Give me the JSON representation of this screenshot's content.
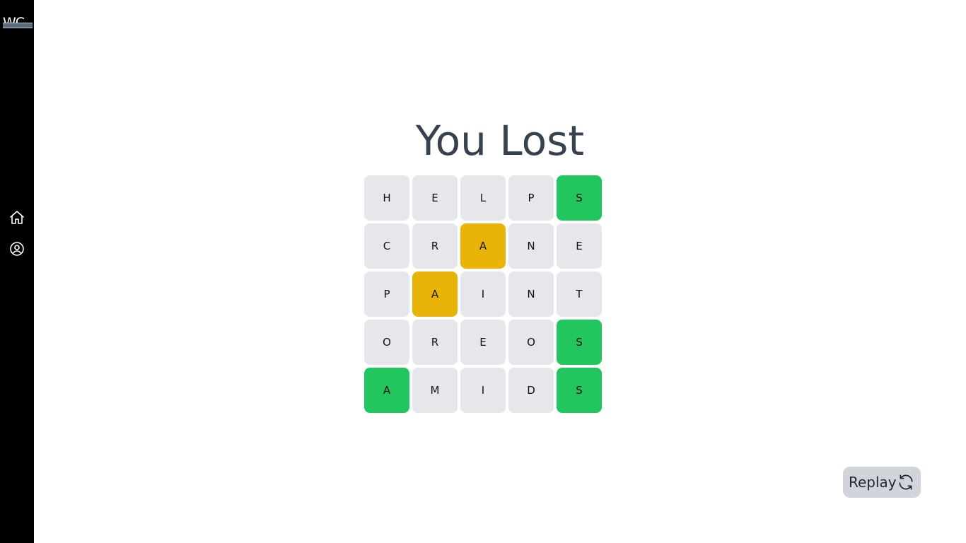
{
  "sidebar": {
    "logo_text": "WC",
    "nav": [
      {
        "icon": "home-icon"
      },
      {
        "icon": "user-circle-icon"
      }
    ]
  },
  "game": {
    "title": "You Lost",
    "rows": [
      [
        {
          "letter": "H",
          "status": "absent"
        },
        {
          "letter": "E",
          "status": "absent"
        },
        {
          "letter": "L",
          "status": "absent"
        },
        {
          "letter": "P",
          "status": "absent"
        },
        {
          "letter": "S",
          "status": "correct"
        }
      ],
      [
        {
          "letter": "C",
          "status": "absent"
        },
        {
          "letter": "R",
          "status": "absent"
        },
        {
          "letter": "A",
          "status": "present"
        },
        {
          "letter": "N",
          "status": "absent"
        },
        {
          "letter": "E",
          "status": "absent"
        }
      ],
      [
        {
          "letter": "P",
          "status": "absent"
        },
        {
          "letter": "A",
          "status": "present"
        },
        {
          "letter": "I",
          "status": "absent"
        },
        {
          "letter": "N",
          "status": "absent"
        },
        {
          "letter": "T",
          "status": "absent"
        }
      ],
      [
        {
          "letter": "O",
          "status": "absent"
        },
        {
          "letter": "R",
          "status": "absent"
        },
        {
          "letter": "E",
          "status": "absent"
        },
        {
          "letter": "O",
          "status": "absent"
        },
        {
          "letter": "S",
          "status": "correct"
        }
      ],
      [
        {
          "letter": "A",
          "status": "correct"
        },
        {
          "letter": "M",
          "status": "absent"
        },
        {
          "letter": "I",
          "status": "absent"
        },
        {
          "letter": "D",
          "status": "absent"
        },
        {
          "letter": "S",
          "status": "correct"
        }
      ]
    ]
  },
  "replay": {
    "label": "Replay",
    "icon": "refresh-icon"
  },
  "colors": {
    "correct": "#22c55e",
    "present": "#eab308",
    "absent": "#e5e7eb",
    "sidebar": "#000000",
    "title": "#374151"
  }
}
